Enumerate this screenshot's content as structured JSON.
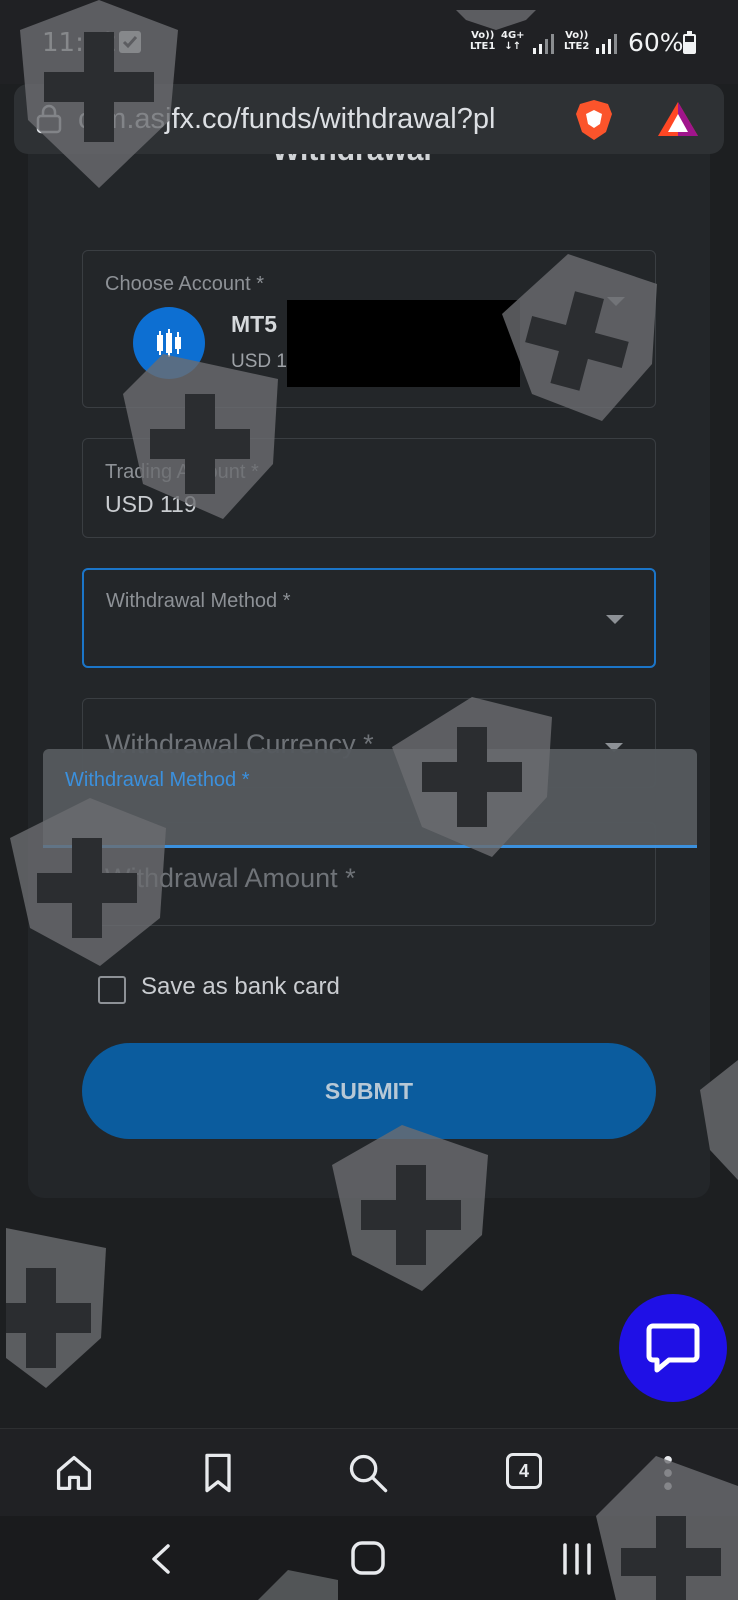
{
  "status_bar": {
    "time": "11:12",
    "sim1_line1": "Vo))",
    "sim1_line2": "LTE1",
    "network_line1": "4G+",
    "network_line2": "↓↑",
    "sim2_line1": "Vo))",
    "sim2_line2": "LTE2",
    "battery": "60%"
  },
  "browser": {
    "url": "crm.asjfx.co/funds/withdrawal?pl",
    "tab_count": "4"
  },
  "page": {
    "title": "Withdrawal",
    "choose_account": {
      "label": "Choose Account *",
      "account_name": "MT5",
      "account_balance": "USD 1"
    },
    "trading_amount": {
      "label": "Trading Amount *",
      "value": "USD 119"
    },
    "withdrawal_method": {
      "label": "Withdrawal Method *"
    },
    "withdrawal_currency": {
      "label": "Withdrawal Currency *"
    },
    "withdrawal_amount": {
      "placeholder": "Withdrawal Amount *"
    },
    "save_bank_card": {
      "label": "Save as bank card",
      "checked": false
    },
    "submit_label": "SUBMIT"
  },
  "overlay": {
    "label": "Withdrawal Method *"
  },
  "colors": {
    "accent_blue": "#1b75c8",
    "submit_bg": "#0b5c9e",
    "chat_bubble": "#1f10e6"
  }
}
